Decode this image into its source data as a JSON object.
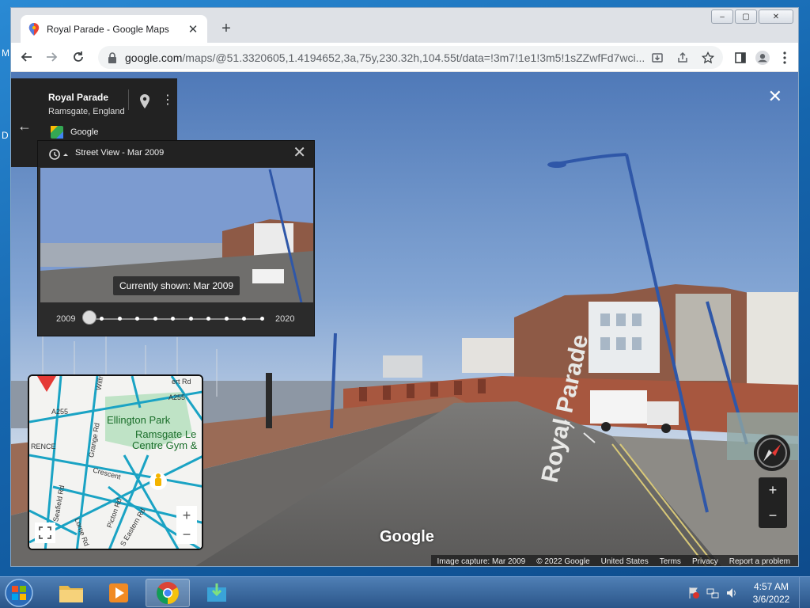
{
  "desktop": {
    "side_letters": [
      "M",
      "D"
    ]
  },
  "browser": {
    "tab": {
      "title": "Royal Parade - Google Maps"
    },
    "new_tab_label": "+",
    "window_controls": [
      "–",
      "▢",
      "✕"
    ],
    "url": {
      "host": "google.com",
      "path": "/maps/@51.3320605,1.4194652,3a,75y,230.32h,104.55t/data=!3m7!1e1!3m5!1sZZwfFd7wci..."
    }
  },
  "streetview": {
    "close_label": "✕",
    "place": {
      "title": "Royal Parade",
      "subtitle": "Ramsgate, England",
      "source": "Google"
    },
    "time_travel": {
      "title": "Street View - Mar 2009",
      "currently_shown": "Currently shown: Mar 2009",
      "start_year": "2009",
      "end_year": "2020",
      "slider_position": 0,
      "stops": 10
    },
    "minimap": {
      "labels": [
        "Ellington Park",
        "Ramsgate Le",
        "Centre Gym &"
      ],
      "roads": [
        "A255",
        "A255",
        "Grange Rd",
        "Crescent",
        "Seafield Rd",
        "Picton Rd",
        "S Eastern Rd",
        "Lorne Rd",
        "RENCE",
        "Wilfr",
        "ert Rd"
      ],
      "zoom_in": "+",
      "zoom_out": "−"
    },
    "zoom_in": "+",
    "zoom_out": "−",
    "road_text": "Royal Parade",
    "logo": "Google",
    "attribution": [
      "Image capture: Mar 2009",
      "© 2022 Google",
      "United States",
      "Terms",
      "Privacy",
      "Report a problem"
    ]
  },
  "taskbar": {
    "time": "4:57 AM",
    "date": "3/6/2022"
  },
  "colors": {
    "accent": "#1a73e8",
    "map_road": "#1aa3c4",
    "sky_top": "#5b86c5",
    "road": "#6b6a6a"
  }
}
